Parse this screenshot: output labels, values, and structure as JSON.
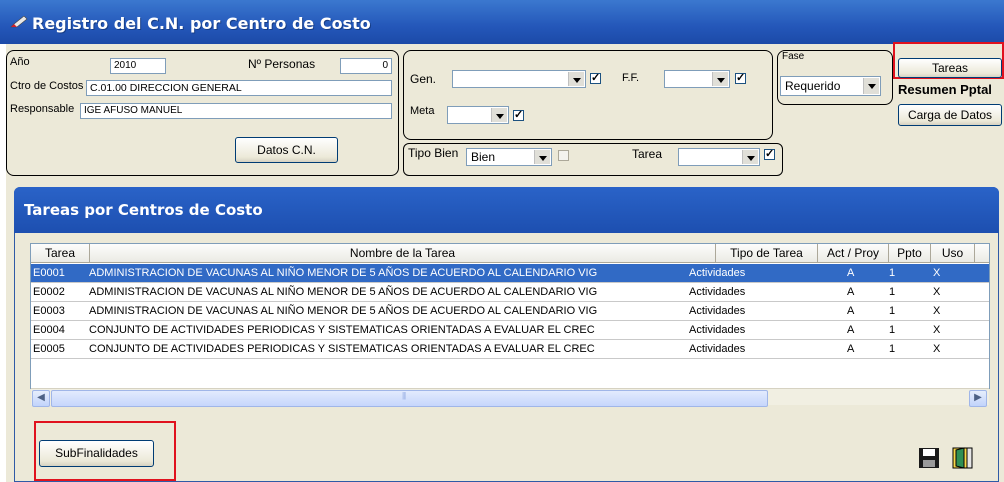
{
  "window": {
    "title": "Registro del C.N. por Centro de Costo"
  },
  "form": {
    "anio_label": "Año",
    "anio_value": "2010",
    "personas_label": "Nº Personas",
    "personas_value": "0",
    "ctro_label": "Ctro de Costos",
    "ctro_value": "C.01.00  DIRECCION GENERAL",
    "resp_label": "Responsable",
    "resp_value": "IGE AFUSO MANUEL",
    "datos_cn_button": "Datos C.N.",
    "gen_label": "Gen.",
    "gen_value": "",
    "ff_label": "F.F.",
    "ff_value": "",
    "meta_label": "Meta",
    "meta_value": "",
    "fase_label": "Fase",
    "fase_value": "Requerido",
    "tipo_bien_label": "Tipo Bien",
    "tipo_bien_value": "Bien",
    "tarea_label": "Tarea",
    "tarea_value": "",
    "tareas_button": "Tareas",
    "resumen_label": "Resumen Pptal",
    "carga_button": "Carga de Datos"
  },
  "panel": {
    "title": "Tareas por Centros de Costo",
    "columns": [
      "Tarea",
      "Nombre de la Tarea",
      "Tipo de Tarea",
      "Act / Proy",
      "Ppto",
      "Uso"
    ],
    "rows": [
      {
        "tarea": "E0001",
        "nombre": "ADMINISTRACION DE VACUNAS AL NIÑO MENOR DE 5 AÑOS DE ACUERDO AL CALENDARIO VIG",
        "tipo": "Actividades",
        "act": "A",
        "ppto": "1",
        "uso": "X"
      },
      {
        "tarea": "E0002",
        "nombre": "ADMINISTRACION DE VACUNAS AL NIÑO MENOR DE 5 AÑOS DE ACUERDO AL CALENDARIO VIG",
        "tipo": "Actividades",
        "act": "A",
        "ppto": "1",
        "uso": "X"
      },
      {
        "tarea": "E0003",
        "nombre": "ADMINISTRACION DE VACUNAS AL NIÑO MENOR DE 5 AÑOS DE ACUERDO AL CALENDARIO VIG",
        "tipo": "Actividades",
        "act": "A",
        "ppto": "1",
        "uso": "X"
      },
      {
        "tarea": "E0004",
        "nombre": "CONJUNTO DE ACTIVIDADES PERIODICAS Y SISTEMATICAS ORIENTADAS A EVALUAR EL CREC",
        "tipo": "Actividades",
        "act": "A",
        "ppto": "1",
        "uso": "X"
      },
      {
        "tarea": "E0005",
        "nombre": "CONJUNTO DE ACTIVIDADES PERIODICAS Y SISTEMATICAS ORIENTADAS A EVALUAR EL CREC",
        "tipo": "Actividades",
        "act": "A",
        "ppto": "1",
        "uso": "X"
      }
    ],
    "subfinalidades_button": "SubFinalidades",
    "save_icon": "floppy-disk-icon",
    "exit_icon": "exit-door-icon"
  },
  "colors": {
    "titlebar": "#2457b9",
    "selection": "#316ac5",
    "highlight": "#e0121e",
    "face": "#ece9d8"
  }
}
